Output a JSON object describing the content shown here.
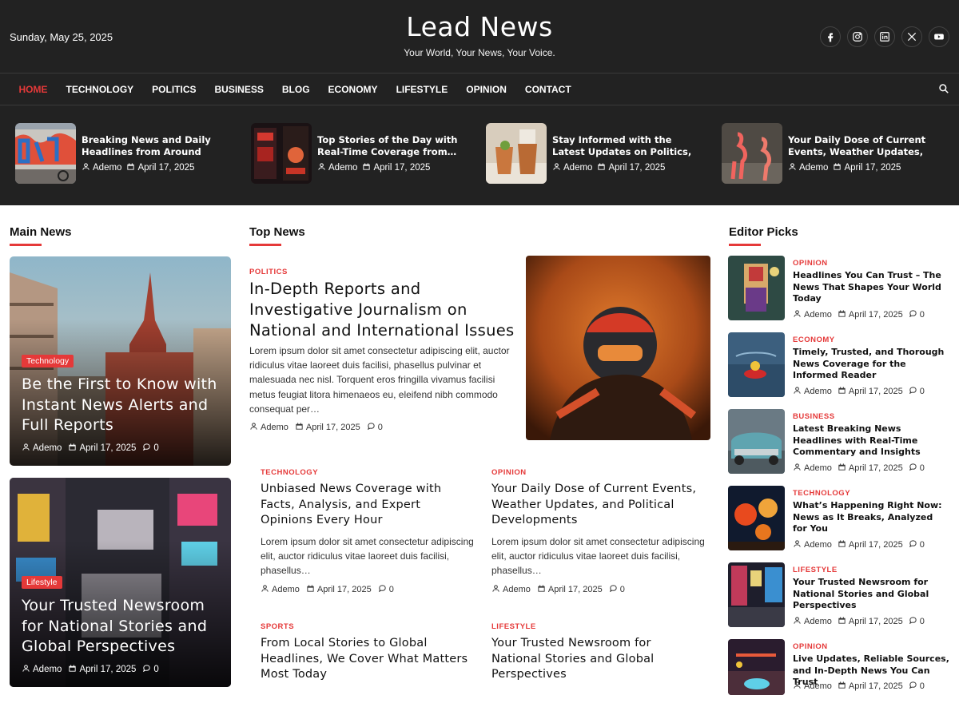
{
  "header": {
    "date": "Sunday, May 25, 2025",
    "site_title": "Lead News",
    "tagline": "Your World, Your News, Your Voice.",
    "socials": [
      "facebook-icon",
      "instagram-icon",
      "linkedin-icon",
      "x-icon",
      "youtube-icon"
    ]
  },
  "nav": {
    "items": [
      {
        "label": "HOME",
        "active": true
      },
      {
        "label": "TECHNOLOGY"
      },
      {
        "label": "POLITICS"
      },
      {
        "label": "BUSINESS"
      },
      {
        "label": "BLOG"
      },
      {
        "label": "ECONOMY"
      },
      {
        "label": "LIFESTYLE"
      },
      {
        "label": "OPINION"
      },
      {
        "label": "CONTACT"
      }
    ]
  },
  "ticker": [
    {
      "title": "Breaking News and Daily Headlines from Around the…",
      "author": "Ademo",
      "date": "April 17, 2025"
    },
    {
      "title": "Top Stories of the Day with Real-Time Coverage from…",
      "author": "Ademo",
      "date": "April 17, 2025"
    },
    {
      "title": "Stay Informed with the Latest Updates on Politics, Sports, an…",
      "author": "Ademo",
      "date": "April 17, 2025"
    },
    {
      "title": "Your Daily Dose of Current Events, Weather Updates, and…",
      "author": "Ademo",
      "date": "April 17, 2025"
    }
  ],
  "sections": {
    "main": "Main News",
    "top": "Top News",
    "editor": "Editor Picks"
  },
  "main_news": [
    {
      "category": "Technology",
      "title": "Be the First to Know with Instant News Alerts and Full Reports",
      "author": "Ademo",
      "date": "April 17, 2025",
      "comments": "0"
    },
    {
      "category": "Lifestyle",
      "title": "Your Trusted Newsroom for National Stories and Global Perspectives",
      "author": "Ademo",
      "date": "April 17, 2025",
      "comments": "0"
    }
  ],
  "top_news": {
    "featured": {
      "category": "POLITICS",
      "title": "In-Depth Reports and Investigative Journalism on National and International Issues",
      "excerpt": "Lorem ipsum dolor sit amet consectetur adipiscing elit, auctor ridiculus vitae laoreet duis facilisi, phasellus pulvinar et malesuada nec nisl. Torquent eros fringilla vivamus facilisi metus feugiat litora himenaeos eu, eleifend nibh commodo consequat per…",
      "author": "Ademo",
      "date": "April 17, 2025",
      "comments": "0"
    },
    "items": [
      {
        "category": "TECHNOLOGY",
        "title": "Unbiased News Coverage with Facts, Analysis, and Expert Opinions Every Hour",
        "excerpt": "Lorem ipsum dolor sit amet consectetur adipiscing elit, auctor ridiculus vitae laoreet duis facilisi, phasellus…",
        "author": "Ademo",
        "date": "April 17, 2025",
        "comments": "0"
      },
      {
        "category": "OPINION",
        "title": "Your Daily Dose of Current Events, Weather Updates, and Political Developments",
        "excerpt": "Lorem ipsum dolor sit amet consectetur adipiscing elit, auctor ridiculus vitae laoreet duis facilisi, phasellus…",
        "author": "Ademo",
        "date": "April 17, 2025",
        "comments": "0"
      },
      {
        "category": "SPORTS",
        "title": "From Local Stories to Global Headlines, We Cover What Matters Most Today"
      },
      {
        "category": "LIFESTYLE",
        "title": "Your Trusted Newsroom for National Stories and Global Perspectives"
      }
    ]
  },
  "editor_picks": [
    {
      "category": "OPINION",
      "title": "Headlines You Can Trust – The News That Shapes Your World Today",
      "author": "Ademo",
      "date": "April 17, 2025",
      "comments": "0"
    },
    {
      "category": "ECONOMY",
      "title": "Timely, Trusted, and Thorough News Coverage for the Informed Reader",
      "author": "Ademo",
      "date": "April 17, 2025",
      "comments": "0"
    },
    {
      "category": "BUSINESS",
      "title": "Latest Breaking News Headlines with Real-Time Commentary and Insights",
      "author": "Ademo",
      "date": "April 17, 2025",
      "comments": "0"
    },
    {
      "category": "TECHNOLOGY",
      "title": "What’s Happening Right Now: News as It Breaks, Analyzed for You",
      "author": "Ademo",
      "date": "April 17, 2025",
      "comments": "0"
    },
    {
      "category": "LIFESTYLE",
      "title": "Your Trusted Newsroom for National Stories and Global Perspectives",
      "author": "Ademo",
      "date": "April 17, 2025",
      "comments": "0"
    },
    {
      "category": "OPINION",
      "title": "Live Updates, Reliable Sources, and In-Depth News You Can Trust",
      "author": "Ademo",
      "date": "April 17, 2025",
      "comments": "0"
    }
  ],
  "colors": {
    "accent": "#e53939",
    "header_bg": "#222222"
  }
}
